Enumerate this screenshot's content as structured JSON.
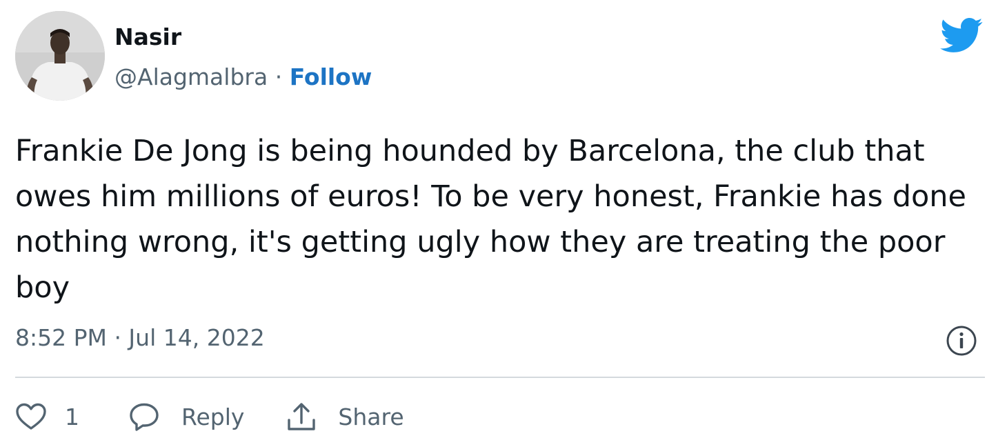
{
  "colors": {
    "twitter_blue": "#1d9bf0",
    "follow_link": "#1d74c4",
    "secondary_text": "#536471",
    "primary_text": "#0f1419",
    "divider": "#d4d9dd"
  },
  "tweet": {
    "author": {
      "display_name": "Nasir",
      "handle": "@Alagmalbra",
      "separator": "·",
      "follow_label": "Follow"
    },
    "brand_icon": "twitter-bird-icon",
    "text": "Frankie De Jong is being hounded by Barcelona, the club that owes him millions of euros! To be very honest, Frankie has done nothing wrong, it's getting ugly how they are treating the poor boy",
    "timestamp": "8:52 PM · Jul 14, 2022",
    "info_icon": "info-circle-icon",
    "actions": {
      "like": {
        "icon": "heart-icon",
        "count": "1"
      },
      "reply": {
        "icon": "speech-bubble-icon",
        "label": "Reply"
      },
      "share": {
        "icon": "share-upload-icon",
        "label": "Share"
      }
    }
  }
}
